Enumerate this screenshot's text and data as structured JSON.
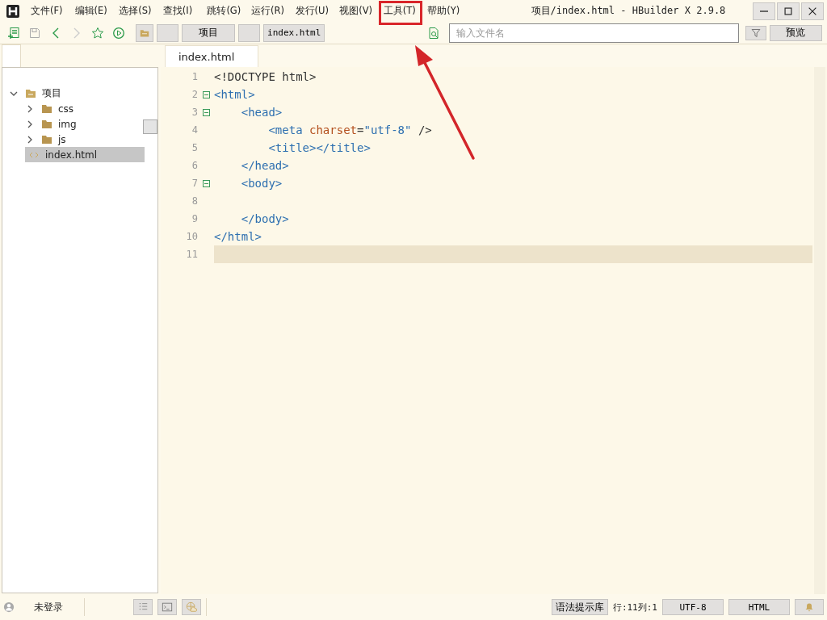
{
  "window": {
    "title": "项目/index.html - HBuilder X 2.9.8"
  },
  "menu": [
    "文件(F)",
    "编辑(E)",
    "选择(S)",
    "查找(I)",
    "跳转(G)",
    "运行(R)",
    "发行(U)",
    "视图(V)",
    "工具(T)",
    "帮助(Y)"
  ],
  "toolbar": {
    "breadcrumb": [
      "项目",
      "index.html"
    ],
    "search": {
      "placeholder": "输入文件名"
    },
    "preview_button": "预览"
  },
  "tabs": [
    {
      "label": "index.html",
      "selected": true
    }
  ],
  "tree": [
    {
      "label": "项目",
      "kind": "folder",
      "expanded": true,
      "selected": false,
      "children": [
        {
          "label": "css",
          "kind": "folder",
          "expanded": false,
          "selected": false
        },
        {
          "label": "img",
          "kind": "folder",
          "expanded": false,
          "selected": false
        },
        {
          "label": "js",
          "kind": "folder",
          "expanded": false,
          "selected": false
        },
        {
          "label": "index.html",
          "kind": "file",
          "selected": true
        }
      ]
    }
  ],
  "editor": {
    "lines": [
      {
        "number": "1",
        "foldable": false,
        "current": false,
        "tokens": [
          {
            "kind": "plain",
            "text": "<!DOCTYPE html>"
          }
        ]
      },
      {
        "number": "2",
        "foldable": true,
        "current": false,
        "tokens": [
          {
            "kind": "tag",
            "text": "<html>"
          }
        ]
      },
      {
        "number": "3",
        "foldable": true,
        "current": false,
        "tokens": [
          {
            "kind": "tag",
            "text": "    <head>"
          }
        ]
      },
      {
        "number": "4",
        "foldable": false,
        "current": false,
        "tokens": [
          {
            "kind": "tag",
            "text": "        <meta"
          },
          {
            "kind": "attr",
            "text": " charset"
          },
          {
            "kind": "plain",
            "text": "="
          },
          {
            "kind": "string",
            "text": "\"utf-8\""
          },
          {
            "kind": "plain",
            "text": " />"
          }
        ]
      },
      {
        "number": "5",
        "foldable": false,
        "current": false,
        "tokens": [
          {
            "kind": "tag",
            "text": "        <title></title>"
          }
        ]
      },
      {
        "number": "6",
        "foldable": false,
        "current": false,
        "tokens": [
          {
            "kind": "tag",
            "text": "    </head>"
          }
        ]
      },
      {
        "number": "7",
        "foldable": true,
        "current": false,
        "tokens": [
          {
            "kind": "tag",
            "text": "    <body>"
          }
        ]
      },
      {
        "number": "8",
        "foldable": false,
        "current": false
      },
      {
        "number": "9",
        "foldable": false,
        "current": false,
        "tokens": [
          {
            "kind": "tag",
            "text": "    </body>"
          }
        ]
      },
      {
        "number": "10",
        "foldable": false,
        "current": false,
        "tokens": [
          {
            "kind": "tag",
            "text": "</html>"
          }
        ]
      },
      {
        "number": "11",
        "foldable": false,
        "current": true
      }
    ]
  },
  "status_bar": {
    "account": "未登录",
    "syntax_button": "语法提示库",
    "position": "行:11列:1",
    "encoding": "UTF-8",
    "language": "HTML"
  }
}
